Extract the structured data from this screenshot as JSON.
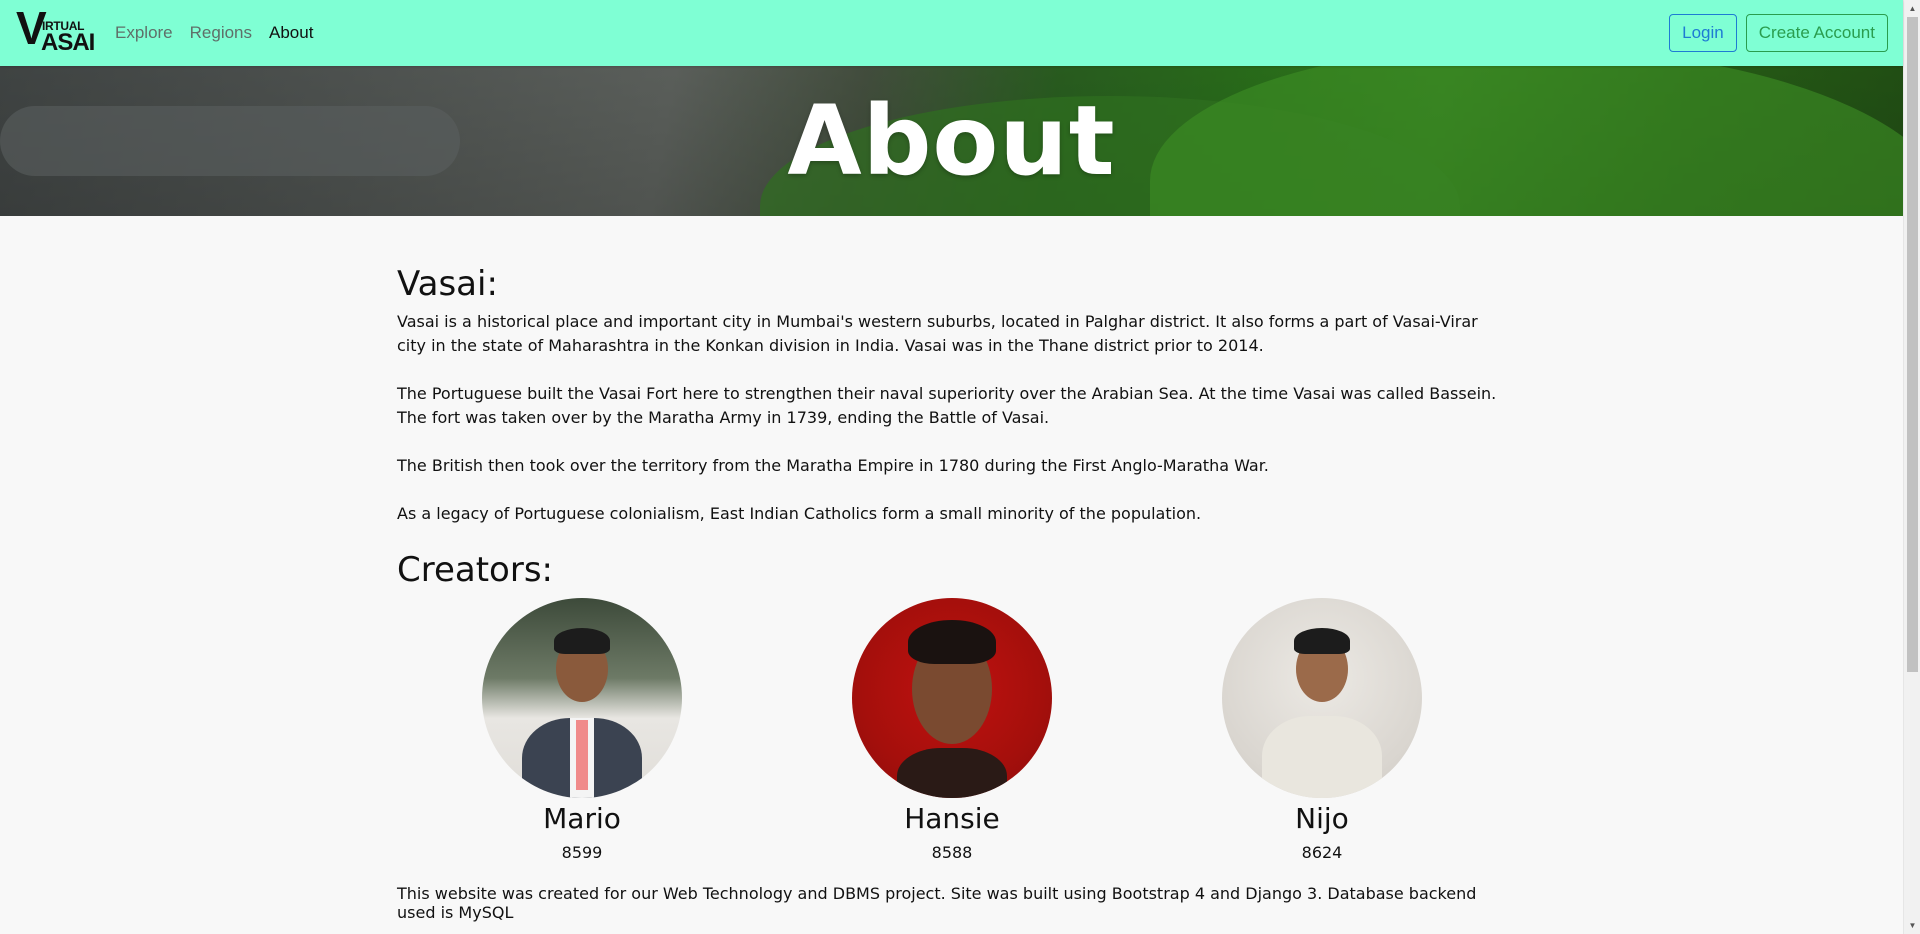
{
  "nav": {
    "brand_letters": [
      "V",
      "IRTUAL",
      "ASAI"
    ],
    "links": [
      {
        "label": "Explore",
        "active": false
      },
      {
        "label": "Regions",
        "active": false
      },
      {
        "label": "About",
        "active": true
      }
    ],
    "login_label": "Login",
    "create_account_label": "Create Account"
  },
  "hero": {
    "title": "About"
  },
  "vasai": {
    "heading": "Vasai:",
    "paragraphs": [
      "Vasai is a historical place and important city in Mumbai's western suburbs, located in Palghar district. It also forms a part of Vasai-Virar city in the state of Maharashtra in the Konkan division in India. Vasai was in the Thane district prior to 2014.",
      "The Portuguese built the Vasai Fort here to strengthen their naval superiority over the Arabian Sea. At the time Vasai was called Bassein. The fort was taken over by the Maratha Army in 1739, ending the Battle of Vasai.",
      "The British then took over the territory from the Maratha Empire in 1780 during the First Anglo-Maratha War.",
      "As a legacy of Portuguese colonialism, East Indian Catholics form a small minority of the population."
    ]
  },
  "creators": {
    "heading": "Creators:",
    "people": [
      {
        "name": "Mario",
        "id": "8599"
      },
      {
        "name": "Hansie",
        "id": "8588"
      },
      {
        "name": "Nijo",
        "id": "8624"
      }
    ]
  },
  "footer_note": "This website was created for our Web Technology and DBMS project. Site was built using Bootstrap 4 and Django 3. Database backend used is MySQL",
  "colors": {
    "navbar_bg": "#7fffd4",
    "login_border": "#1e7bd3",
    "create_border": "#2a9d4e",
    "page_bg": "#f8f8f8"
  }
}
